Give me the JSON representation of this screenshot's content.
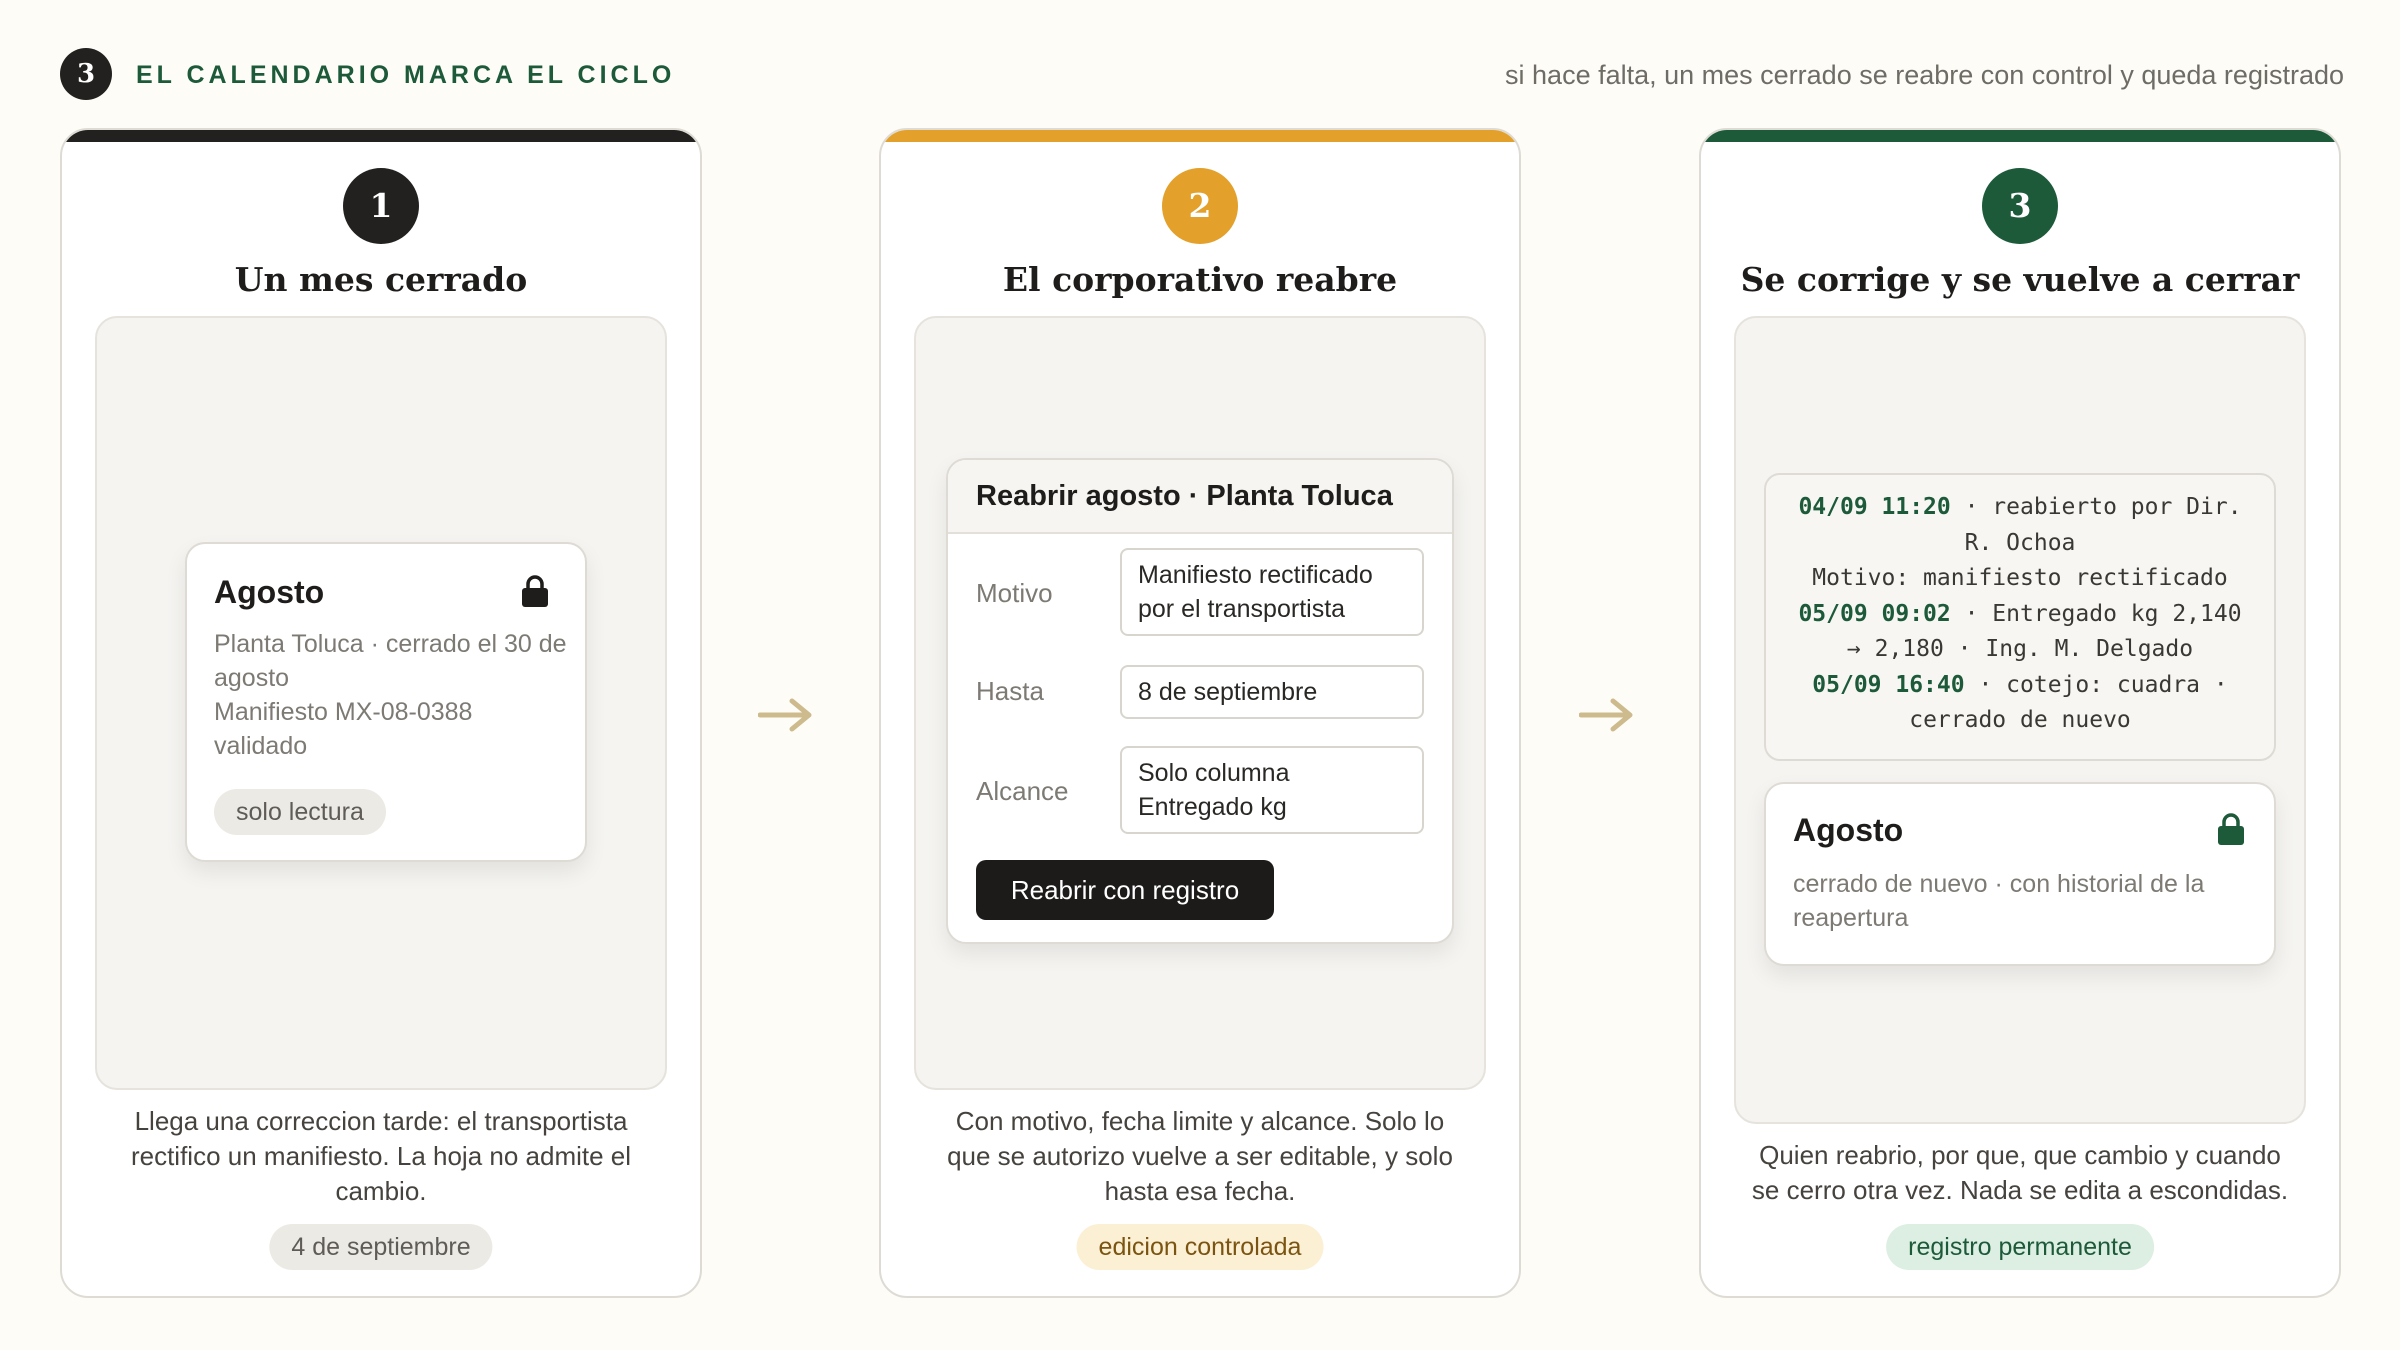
{
  "header": {
    "step_number": "3",
    "title": "EL CALENDARIO MARCA EL CICLO",
    "note": "si hace falta, un mes cerrado se reabre con control y queda registrado"
  },
  "colors": {
    "dark": "#22211f",
    "amber": "#e3a02b",
    "green": "#1d5a3a",
    "arrow": "#cdbb8e"
  },
  "steps": [
    {
      "number": "1",
      "title": "Un mes cerrado",
      "card": {
        "title": "Agosto",
        "icon": "lock-icon",
        "line1": "Planta Toluca · cerrado el 30 de",
        "line2": "agosto",
        "line3": "Manifiesto MX-08-0388",
        "line4": "validado",
        "chip": "solo lectura"
      },
      "description": "Llega una correccion tarde: el transportista rectifico un manifiesto. La hoja no admite el cambio.",
      "badge": "4 de septiembre"
    },
    {
      "number": "2",
      "title": "El corporativo reabre",
      "dialog": {
        "title": "Reabrir agosto · Planta Toluca",
        "fields": [
          {
            "label": "Motivo",
            "value": "Manifiesto rectificado por el transportista"
          },
          {
            "label": "Hasta",
            "value": "8 de septiembre"
          },
          {
            "label": "Alcance",
            "value": "Solo columna Entregado kg"
          }
        ],
        "button": "Reabrir con registro"
      },
      "description": "Con motivo, fecha limite y alcance. Solo lo que se autorizo vuelve a ser editable, y solo hasta esa fecha.",
      "badge": "edicion controlada"
    },
    {
      "number": "3",
      "title": "Se corrige y se vuelve a cerrar",
      "log": [
        {
          "time": "04/09 11:20",
          "text": " · reabierto por Dir."
        },
        {
          "time": "",
          "text": "R. Ochoa"
        },
        {
          "time": "",
          "text": "Motivo: manifiesto rectificado"
        },
        {
          "time": "05/09 09:02",
          "text": " · Entregado kg 2,140"
        },
        {
          "time": "",
          "text": "→ 2,180 · Ing. M. Delgado"
        },
        {
          "time": "05/09 16:40",
          "text": " · cotejo: cuadra ·"
        },
        {
          "time": "",
          "text": "cerrado de nuevo"
        }
      ],
      "card": {
        "title": "Agosto",
        "icon": "lock-icon",
        "line1": "cerrado de nuevo · con historial de la",
        "line2": "reapertura"
      },
      "description": "Quien reabrio, por que, que cambio y cuando se cerro otra vez. Nada se edita a escondidas.",
      "badge": "registro permanente"
    }
  ]
}
